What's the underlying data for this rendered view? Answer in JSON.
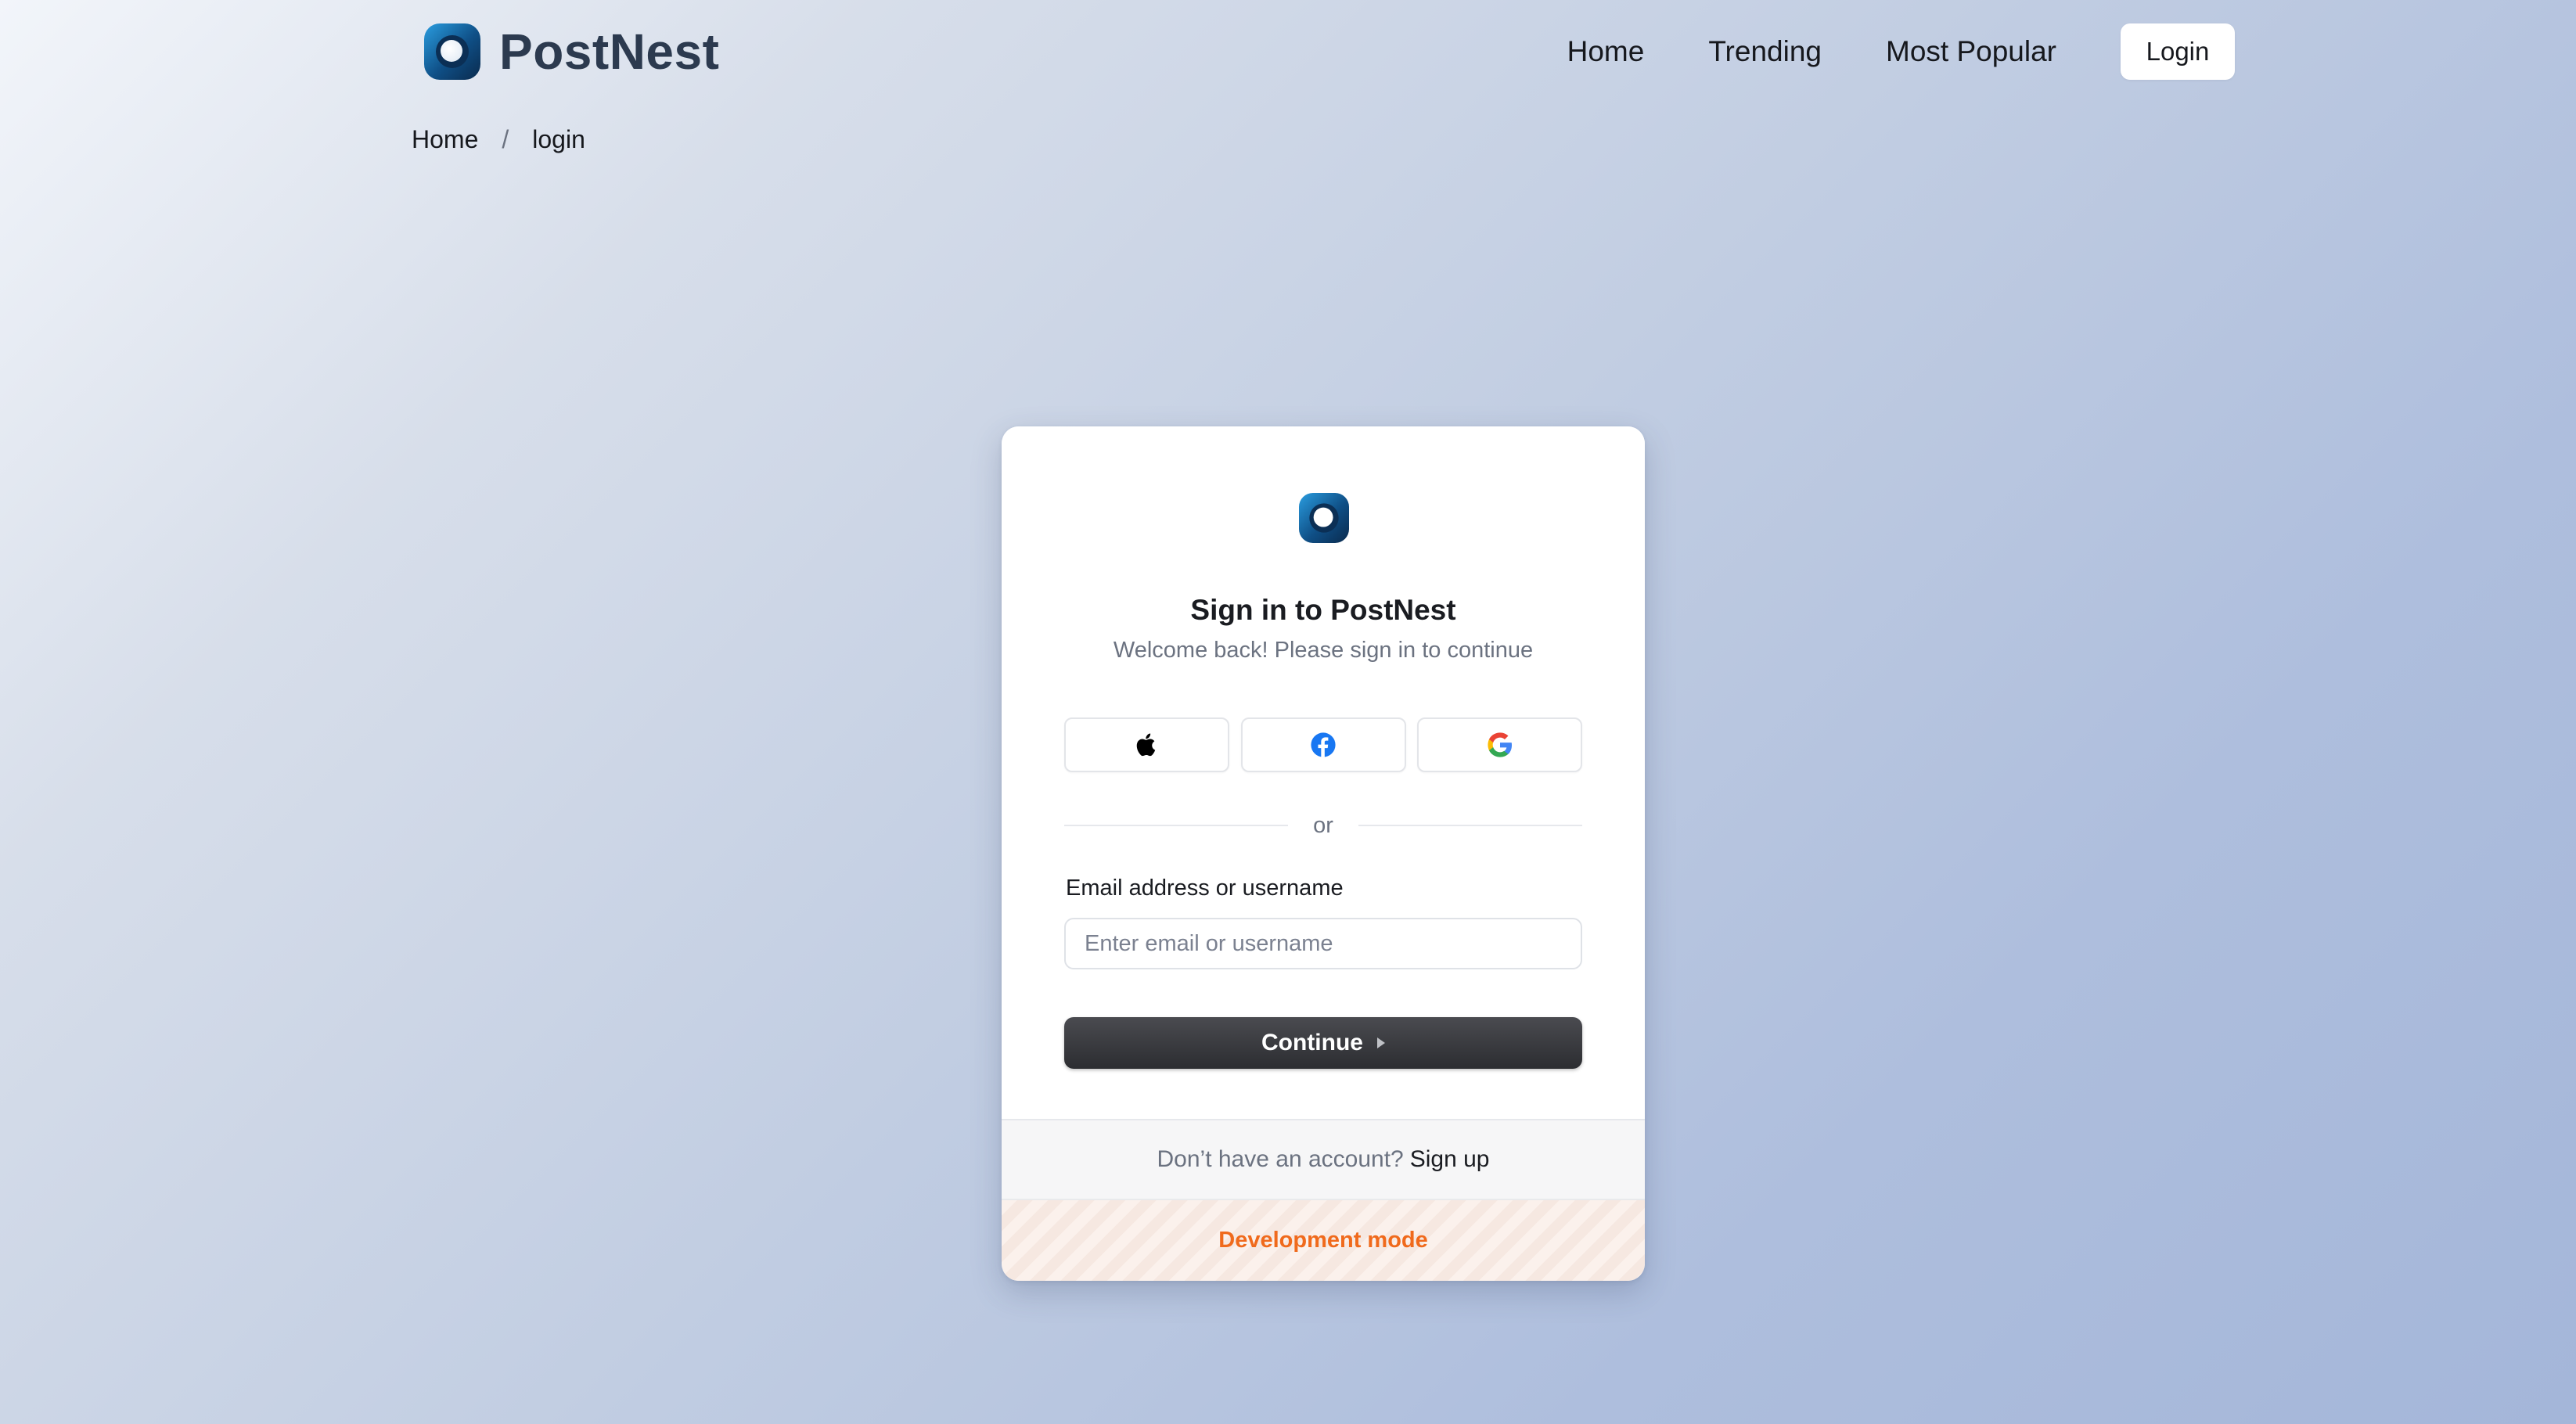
{
  "header": {
    "brand_name": "PostNest",
    "nav": [
      {
        "label": "Home"
      },
      {
        "label": "Trending"
      },
      {
        "label": "Most Popular"
      }
    ],
    "login_label": "Login"
  },
  "breadcrumb": {
    "items": [
      "Home",
      "login"
    ],
    "separator": "/"
  },
  "card": {
    "title": "Sign in to PostNest",
    "subtitle": "Welcome back! Please sign in to continue",
    "social": [
      {
        "icon": "apple-icon"
      },
      {
        "icon": "facebook-icon"
      },
      {
        "icon": "google-icon"
      }
    ],
    "divider_text": "or",
    "email_label": "Email address or username",
    "email_placeholder": "Enter email or username",
    "email_value": "",
    "continue_label": "Continue",
    "footer_text": "Don’t have an account?",
    "signup_label": "Sign up",
    "dev_mode_label": "Development mode"
  },
  "colors": {
    "brand_dark": "#2c3a4f",
    "button_dark": "#2c2d31",
    "dev_orange": "#f06a1c",
    "facebook_blue": "#1877f2"
  }
}
